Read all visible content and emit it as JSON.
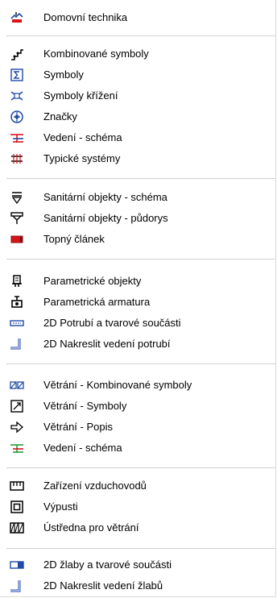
{
  "menu": {
    "items": [
      {
        "label": "Domovní technika",
        "icon": "building-services-icon"
      },
      {
        "label": "Kombinované symboly",
        "icon": "combined-symbols-icon"
      },
      {
        "label": "Symboly",
        "icon": "sigma-symbol-icon"
      },
      {
        "label": "Symboly křížení",
        "icon": "crossing-symbols-icon"
      },
      {
        "label": "Značky",
        "icon": "marker-circle-icon"
      },
      {
        "label": "Vedení - schéma",
        "icon": "pipe-schema-icon"
      },
      {
        "label": "Typické systémy",
        "icon": "typical-systems-icon"
      },
      {
        "label": "Sanitární objekty - schéma",
        "icon": "sanitary-schema-icon"
      },
      {
        "label": "Sanitární objekty - půdorys",
        "icon": "sanitary-plan-icon"
      },
      {
        "label": "Topný článek",
        "icon": "radiator-icon"
      },
      {
        "label": "Parametrické objekty",
        "icon": "parametric-objects-icon"
      },
      {
        "label": "Parametrická armatura",
        "icon": "parametric-valve-icon"
      },
      {
        "label": "2D Potrubí a tvarové součásti",
        "icon": "pipe-fittings-2d-icon"
      },
      {
        "label": "2D Nakreslit vedení potrubí",
        "icon": "draw-pipe-2d-icon"
      },
      {
        "label": "Větrání - Kombinované symboly",
        "icon": "ventilation-combined-icon"
      },
      {
        "label": "Větrání - Symboly",
        "icon": "ventilation-symbols-icon"
      },
      {
        "label": "Větrání - Popis",
        "icon": "arrow-right-outline-icon"
      },
      {
        "label": "Vedení - schéma",
        "icon": "pipe-schema-green-icon"
      },
      {
        "label": "Zařízení vzduchovodů",
        "icon": "duct-equipment-icon"
      },
      {
        "label": "Výpusti",
        "icon": "outlet-icon"
      },
      {
        "label": "Ústředna pro větrání",
        "icon": "ventilation-unit-icon"
      },
      {
        "label": "2D žlaby a tvarové součásti",
        "icon": "gutter-fittings-2d-icon"
      },
      {
        "label": "2D Nakreslit vedení žlabů",
        "icon": "draw-gutter-2d-icon"
      }
    ]
  },
  "colors": {
    "separator": "#d0d0d0",
    "red": "#d8141b",
    "blue": "#1f4aa8",
    "green": "#2a9a3a"
  }
}
